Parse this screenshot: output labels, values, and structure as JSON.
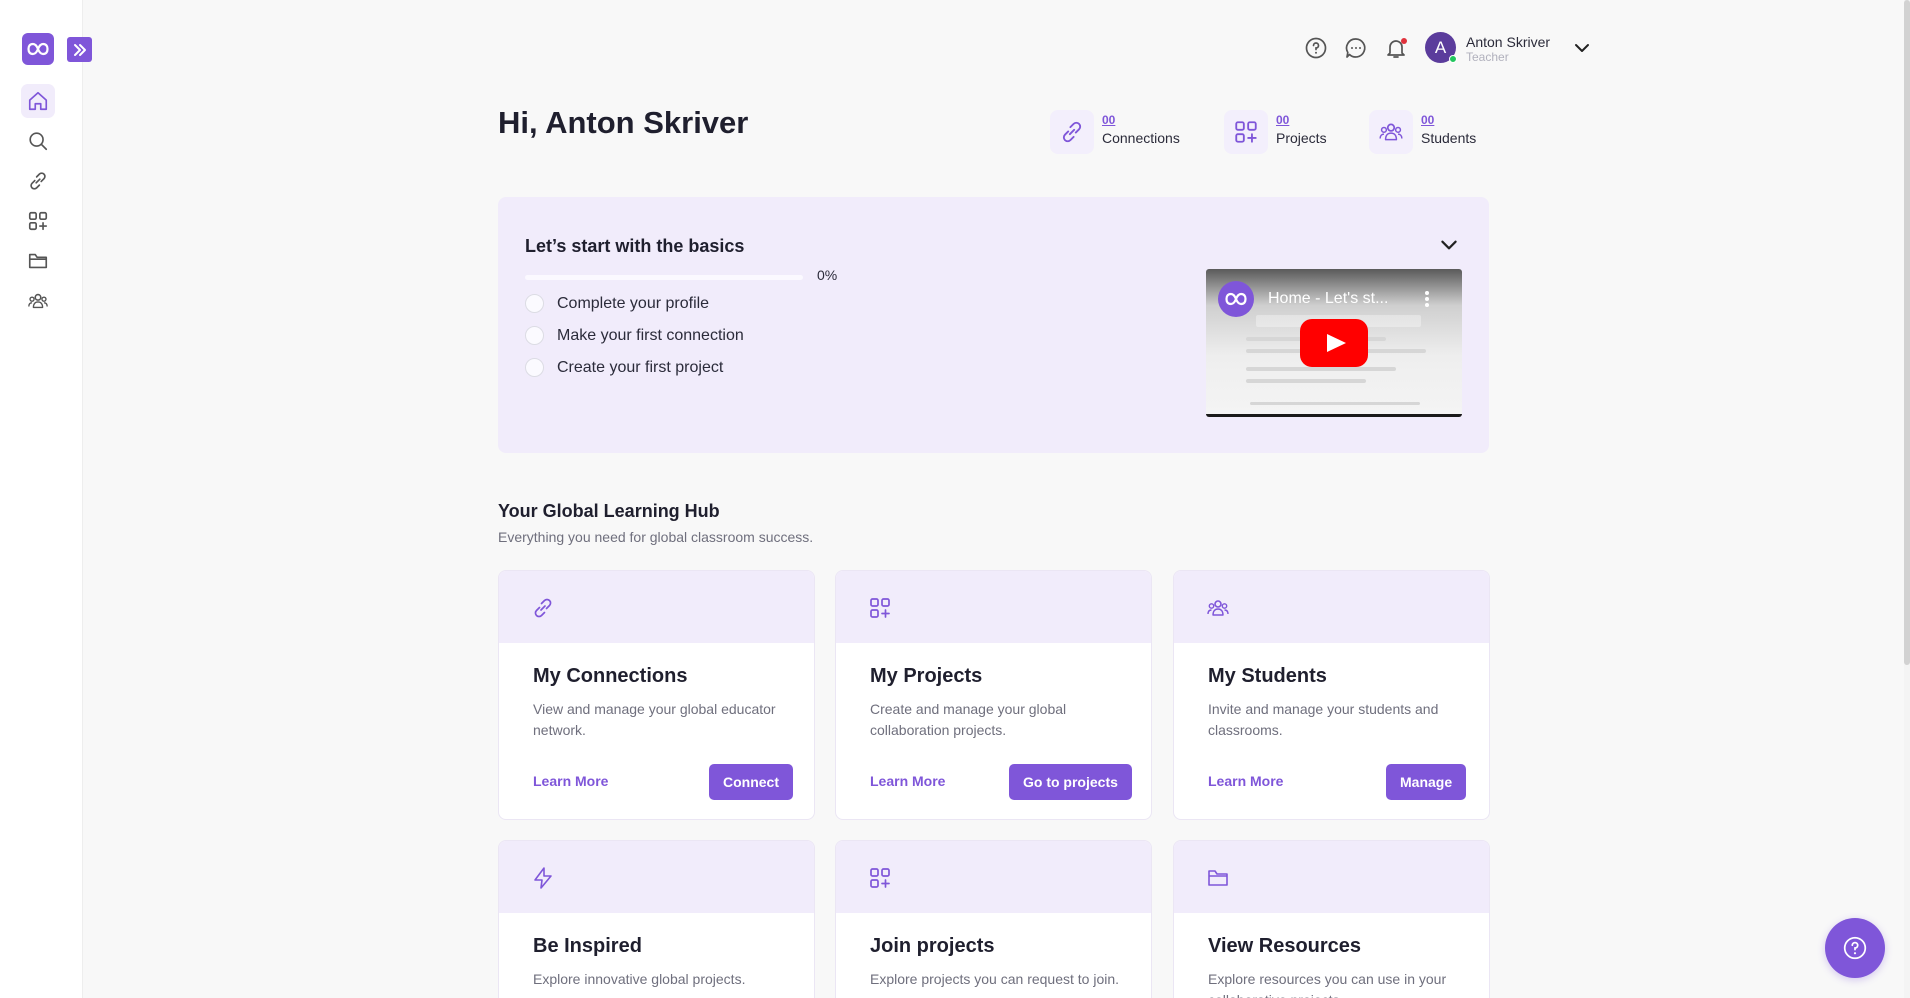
{
  "user": {
    "name": "Anton Skriver",
    "role": "Teacher",
    "avatar_letter": "A"
  },
  "greeting": "Hi, Anton Skriver",
  "stats": [
    {
      "value": "00",
      "label": "Connections",
      "icon": "link-icon"
    },
    {
      "value": "00",
      "label": "Projects",
      "icon": "grid-plus-icon"
    },
    {
      "value": "00",
      "label": "Students",
      "icon": "users-icon"
    }
  ],
  "basics": {
    "title": "Let’s start with the basics",
    "progress_label": "0%",
    "progress_percent": 0,
    "tasks": [
      {
        "label": "Complete your profile",
        "done": false
      },
      {
        "label": "Make your first connection",
        "done": false
      },
      {
        "label": "Create your first project",
        "done": false
      }
    ],
    "video_title": "Home - Let's st..."
  },
  "hub": {
    "title": "Your Global Learning Hub",
    "subtitle": "Everything you need for global classroom success.",
    "cards": [
      {
        "title": "My Connections",
        "desc": "View and manage your global educator network.",
        "learn": "Learn More",
        "action": "Connect",
        "icon": "link-icon"
      },
      {
        "title": "My Projects",
        "desc": "Create and manage your global collaboration projects.",
        "learn": "Learn More",
        "action": "Go to projects",
        "icon": "grid-plus-icon"
      },
      {
        "title": "My Students",
        "desc": "Invite and manage your students and classrooms.",
        "learn": "Learn More",
        "action": "Manage",
        "icon": "users-icon"
      },
      {
        "title": "Be Inspired",
        "desc": "Explore innovative global projects.",
        "icon": "lightning-icon"
      },
      {
        "title": "Join projects",
        "desc": "Explore projects you can request to join.",
        "icon": "grid-plus-icon"
      },
      {
        "title": "View Resources",
        "desc": "Explore resources you can use in your collaborative projects.",
        "icon": "folder-icon"
      }
    ]
  },
  "colors": {
    "accent": "#7f56d9",
    "accent_light": "#f1ecfb",
    "notification": "#e0323c",
    "online": "#22c55e"
  }
}
